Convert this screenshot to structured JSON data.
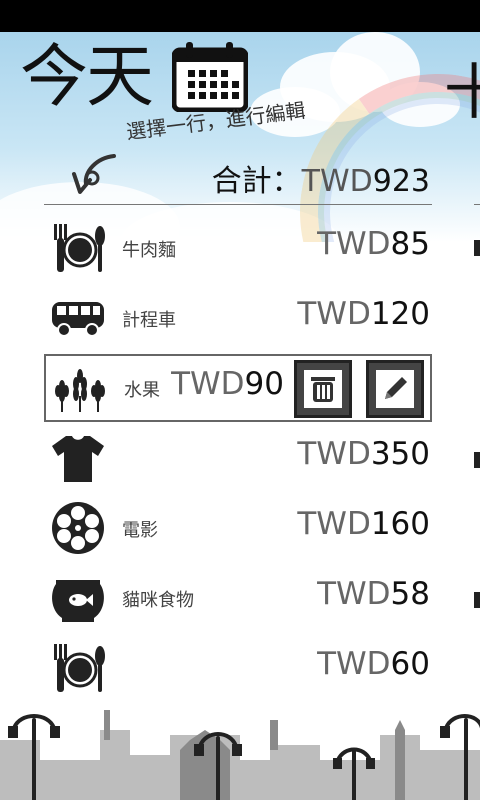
{
  "header": {
    "title": "今天",
    "hint": "選擇一行，進行編輯",
    "total_label": "合計：",
    "total_currency": "TWD",
    "total_amount": "923",
    "next_page_glyph": "十"
  },
  "items": [
    {
      "icon": "dining-icon",
      "label": "牛肉麵",
      "currency": "TWD",
      "amount": "85"
    },
    {
      "icon": "bus-icon",
      "label": "計程車",
      "currency": "TWD",
      "amount": "120"
    },
    {
      "icon": "grain-icon",
      "label": "水果",
      "currency": "TWD",
      "amount": "90",
      "selected": true
    },
    {
      "icon": "tshirt-icon",
      "label": "",
      "currency": "TWD",
      "amount": "350"
    },
    {
      "icon": "film-reel-icon",
      "label": "電影",
      "currency": "TWD",
      "amount": "160"
    },
    {
      "icon": "fishbowl-icon",
      "label": "貓咪食物",
      "currency": "TWD",
      "amount": "58"
    },
    {
      "icon": "dining-icon",
      "label": "",
      "currency": "TWD",
      "amount": "60"
    }
  ],
  "colors": {
    "sky": "#a9d4ec",
    "text": "#111111",
    "currency_text": "#666666",
    "button_fill": "#444444"
  }
}
